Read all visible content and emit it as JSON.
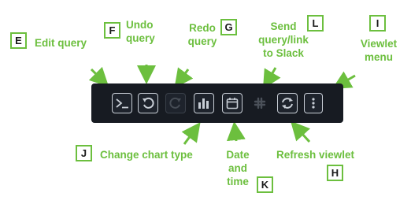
{
  "toolbar": {
    "buttons": [
      {
        "id": "edit-query",
        "icon": "terminal-icon"
      },
      {
        "id": "undo",
        "icon": "undo-icon"
      },
      {
        "id": "redo",
        "icon": "redo-icon",
        "disabled": true
      },
      {
        "id": "chart-type",
        "icon": "bar-chart-icon"
      },
      {
        "id": "date-time",
        "icon": "calendar-icon"
      },
      {
        "id": "slack",
        "icon": "slack-icon",
        "disabled": true
      },
      {
        "id": "refresh",
        "icon": "refresh-icon"
      },
      {
        "id": "menu",
        "icon": "kebab-menu-icon"
      }
    ]
  },
  "annotations": {
    "E": {
      "letter": "E",
      "label": "Edit query"
    },
    "F": {
      "letter": "F",
      "label": "Undo query"
    },
    "G": {
      "letter": "G",
      "label": "Redo query"
    },
    "L": {
      "letter": "L",
      "label": "Send query/link to Slack"
    },
    "I": {
      "letter": "I",
      "label": "Viewlet menu"
    },
    "J": {
      "letter": "J",
      "label": "Change chart type"
    },
    "K": {
      "letter": "K",
      "label": "Date and time"
    },
    "H": {
      "letter": "H",
      "label": "Refresh viewlet"
    }
  },
  "colors": {
    "accent": "#6cbf3e",
    "toolbar_bg": "#171b22",
    "icon": "#c8ced6"
  }
}
